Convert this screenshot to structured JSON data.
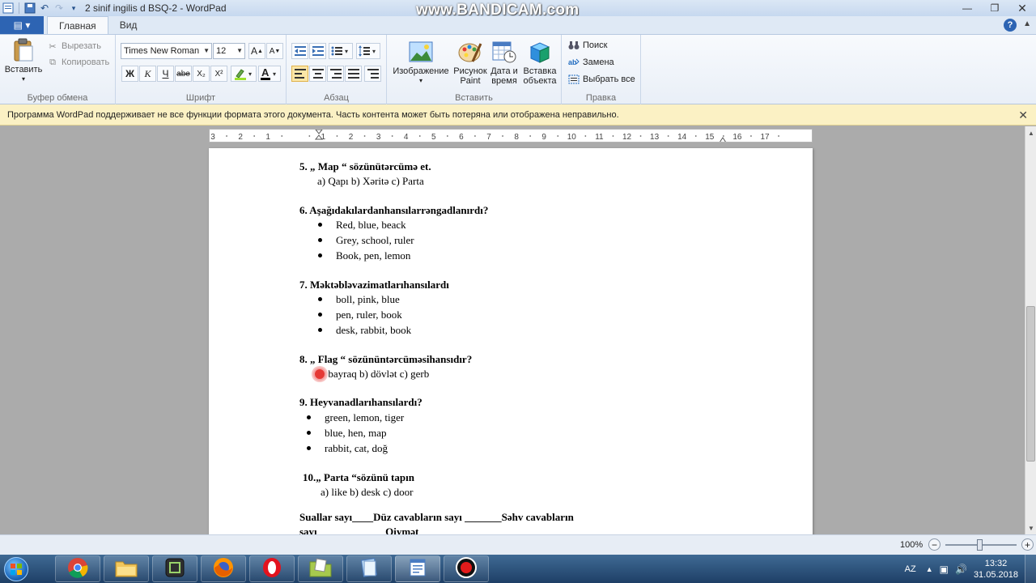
{
  "window": {
    "title": "2 sinif ingilis d BSQ-2 - WordPad",
    "watermark": "www.BANDICAM.com"
  },
  "ribbon": {
    "file_tab": "▤ ▾",
    "tabs": [
      "Главная",
      "Вид"
    ],
    "clipboard": {
      "group_label": "Буфер обмена",
      "paste": "Вставить",
      "cut": "Вырезать",
      "copy": "Копировать"
    },
    "font": {
      "group_label": "Шрифт",
      "family": "Times New Roman",
      "size": "12",
      "bold": "Ж",
      "italic": "К",
      "underline": "Ч",
      "strike": "abe",
      "subscript": "X₂",
      "superscript": "X²"
    },
    "paragraph": {
      "group_label": "Абзац"
    },
    "insert": {
      "group_label": "Вставить",
      "image": "Изображение",
      "paint": "Рисунок Paint",
      "datetime": "Дата и время",
      "object": "Вставка объекта"
    },
    "editing": {
      "group_label": "Правка",
      "find": "Поиск",
      "replace": "Замена",
      "select_all": "Выбрать все"
    }
  },
  "infobar": {
    "message": "Программа WordPad поддерживает не все функции формата этого документа. Часть контента может быть потеряна или отображена неправильно."
  },
  "ruler": {
    "labels": [
      "3",
      "2",
      "1",
      "1",
      "2",
      "3",
      "4",
      "5",
      "6",
      "7",
      "8",
      "9",
      "10",
      "11",
      "12",
      "13",
      "14",
      "15",
      "16",
      "17"
    ]
  },
  "document": {
    "q5": "5. „ Map “ sözünütərcümə et.",
    "q5_options": "a) Qapı        b) Xəritə      c) Parta",
    "q6": "6. Aşağıdakılardanhansılarrəngadlanırdı?",
    "q6_items": [
      "Red, blue, beack",
      "Grey, school, ruler",
      "Book, pen, lemon"
    ],
    "q7": "7. Məktəbləvazimatlarıhansılardı",
    "q7_items": [
      "boll, pink, blue",
      "pen, ruler, book",
      "desk, rabbit, book"
    ],
    "q8": "8. „ Flag “ sözününtərcüməsihansıdır?",
    "q8_options": "a) bayraq    b) dövlət      c) gerb",
    "q9": "9. Heyvanadlarıhansılardı?",
    "q9_items": [
      "green, lemon, tiger",
      "blue, hen, map",
      "rabbit, cat, doğ"
    ],
    "q10": "10.„ Parta “sözünü tapın",
    "q10_options": "a) like    b) desk   c) door",
    "footer1": "Suallar sayı____Düz  cavabların sayı _______Səhv cavabların",
    "footer2": "sayı_____________Qiymət"
  },
  "statusbar": {
    "zoom": "100%",
    "zoom_level_percent": 100
  },
  "taskbar": {
    "lang": "AZ",
    "time": "13:32",
    "date": "31.05.2018"
  }
}
